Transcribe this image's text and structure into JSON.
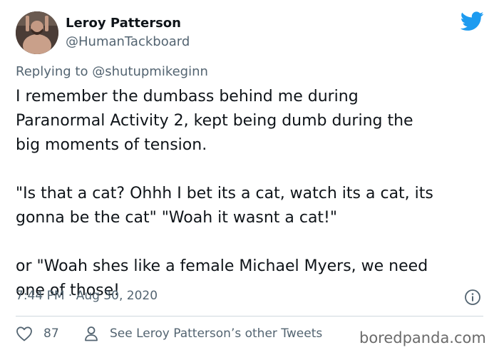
{
  "author": {
    "name": "Leroy Patterson",
    "handle": "@HumanTackboard"
  },
  "reply": {
    "prefix": "Replying to ",
    "mention": "@shutupmikeginn"
  },
  "tweet": {
    "paragraphs": [
      "I remember the dumbass behind me during\nParanormal Activity 2, kept being dumb during the\nbig moments of tension.",
      "\"Is that a cat? Ohhh I bet its a cat, watch its a cat, its\ngonna be the cat\" \"Woah it wasnt a cat!\"",
      "or \"Woah shes like a female Michael Myers, we need\none of those!"
    ],
    "timestamp": "7:44 PM · Aug 30, 2020"
  },
  "actions": {
    "like_count": "87",
    "other_tweets_label": "See Leroy Patterson’s other Tweets"
  },
  "watermark": "boredpanda.com",
  "colors": {
    "twitter_blue": "#1d9bf0",
    "secondary_text": "#536471",
    "divider": "#cfd9de"
  },
  "icons": [
    "avatar",
    "twitter-bird-icon",
    "info-icon",
    "heart-icon",
    "person-icon"
  ]
}
